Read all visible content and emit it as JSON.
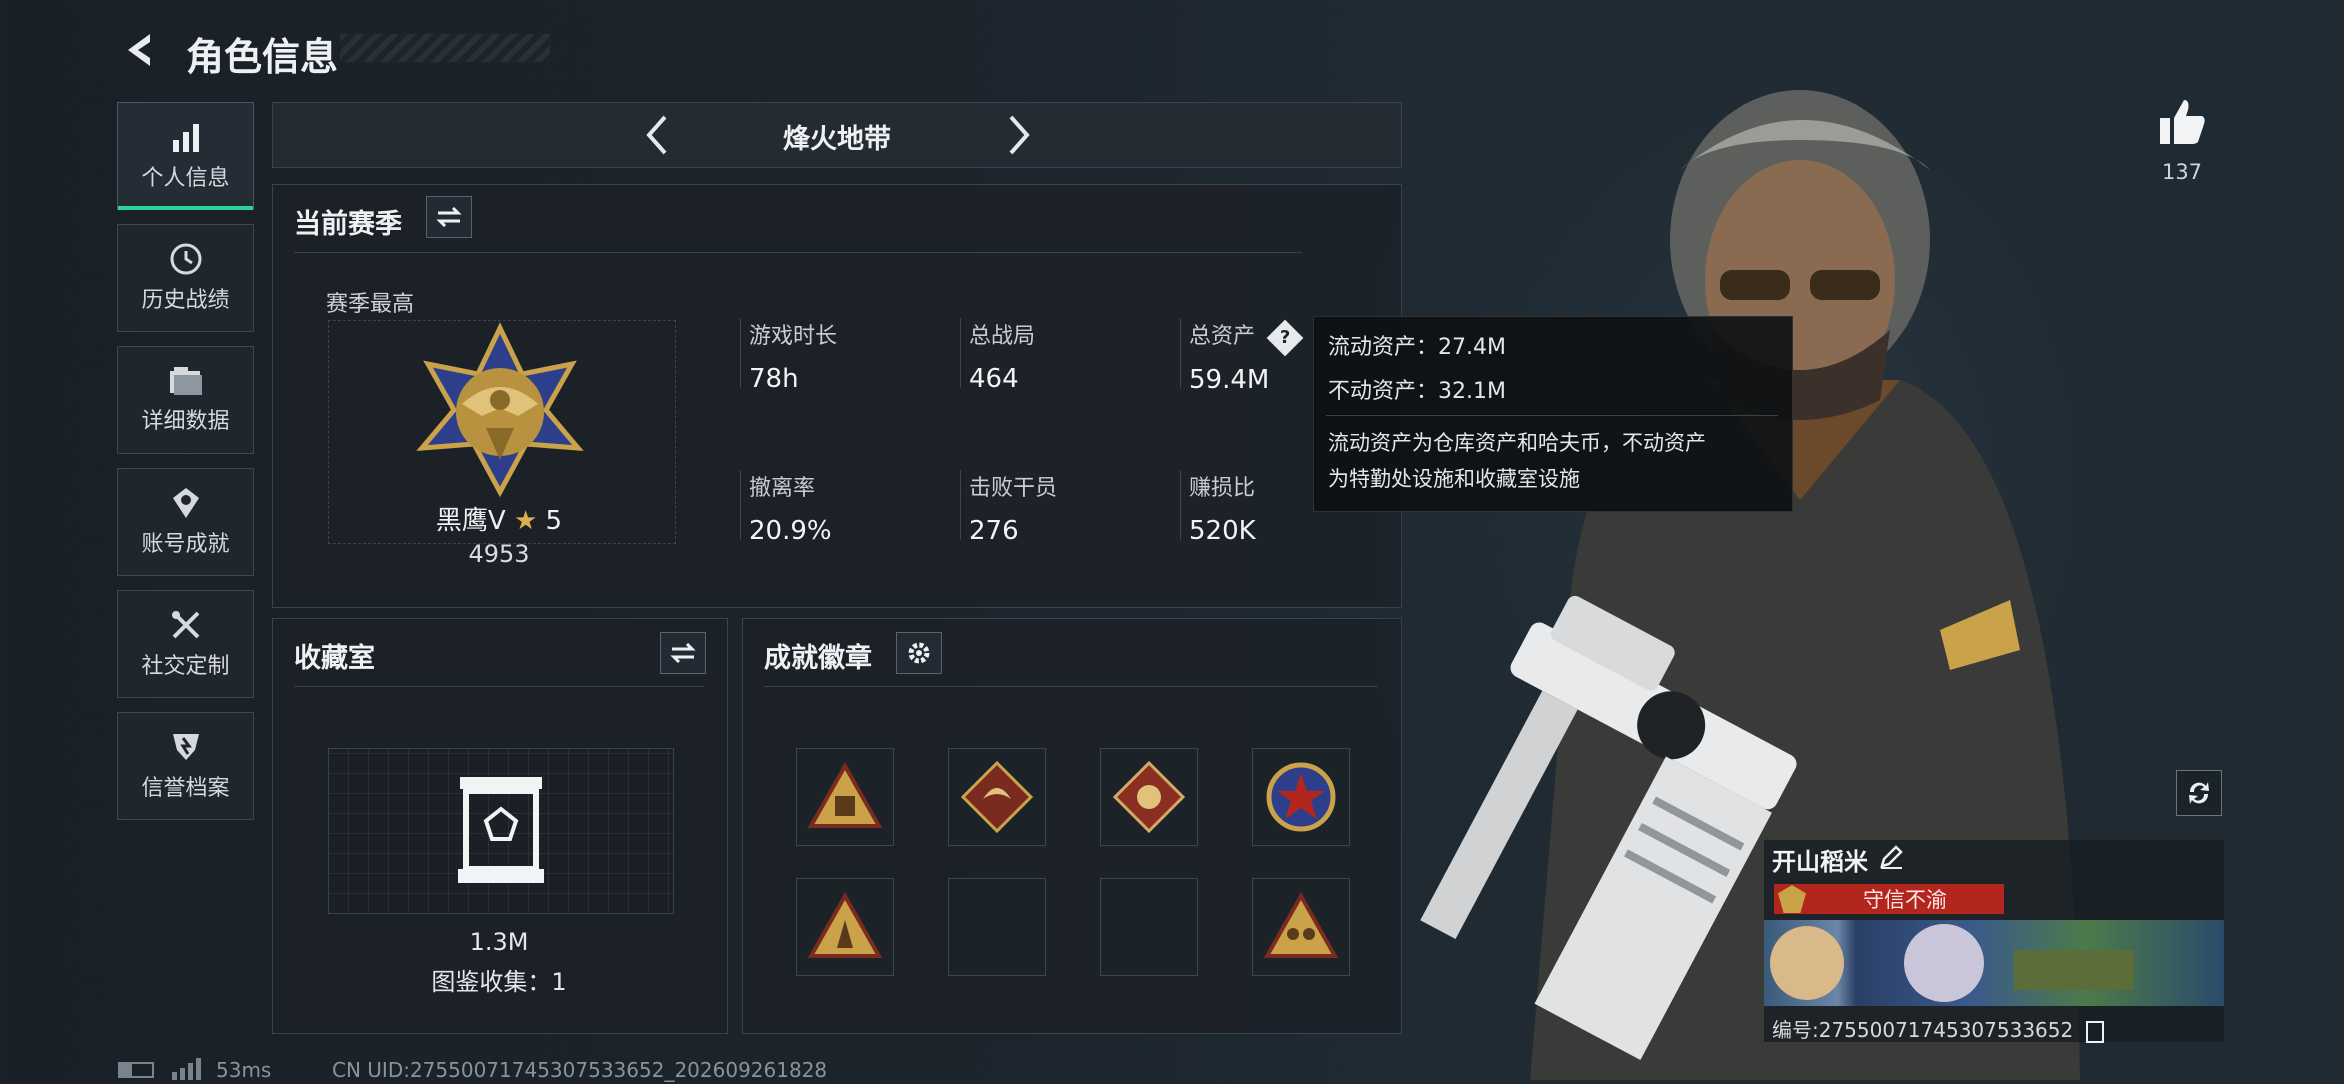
{
  "header": {
    "title": "角色信息"
  },
  "sidebar": {
    "items": [
      {
        "label": "个人信息",
        "icon": "bar-chart-icon",
        "active": true
      },
      {
        "label": "历史战绩",
        "icon": "clock-icon",
        "active": false
      },
      {
        "label": "详细数据",
        "icon": "folder-icon",
        "active": false
      },
      {
        "label": "账号成就",
        "icon": "achievement-icon",
        "active": false
      },
      {
        "label": "社交定制",
        "icon": "tools-icon",
        "active": false
      },
      {
        "label": "信誉档案",
        "icon": "shield-icon",
        "active": false
      }
    ]
  },
  "mode": {
    "title": "烽火地带"
  },
  "season": {
    "title": "当前赛季",
    "best_label": "赛季最高",
    "rank_name": "黑鹰V",
    "rank_stars": "5",
    "rank_points": "4953",
    "stats": [
      {
        "label": "游戏时长",
        "value": "78h"
      },
      {
        "label": "总战局",
        "value": "464"
      },
      {
        "label": "总资产",
        "value": "59.4M"
      },
      {
        "label": "撤离率",
        "value": "20.9%"
      },
      {
        "label": "击败干员",
        "value": "276"
      },
      {
        "label": "赚损比",
        "value": "520K"
      }
    ]
  },
  "tooltip": {
    "liquid": "流动资产：27.4M",
    "fixed": "不动资产：32.1M",
    "desc_line1": "流动资产为仓库资产和哈夫币，不动资产",
    "desc_line2": "为特勤处设施和收藏室设施"
  },
  "collection": {
    "title": "收藏室",
    "value": "1.3M",
    "codex": "图鉴收集：1"
  },
  "badges": {
    "title": "成就徽章"
  },
  "likes": {
    "count": "137"
  },
  "player": {
    "name": "开山稻米",
    "title_badge": "守信不渝",
    "id_label": "编号:27550071745307533652"
  },
  "footer": {
    "ping": "53ms",
    "uid": "CN UID:27550071745307533652_202609261828"
  },
  "colors": {
    "accent": "#2fd39a",
    "gold": "#c9a24a",
    "red_badge": "#b3261e"
  }
}
